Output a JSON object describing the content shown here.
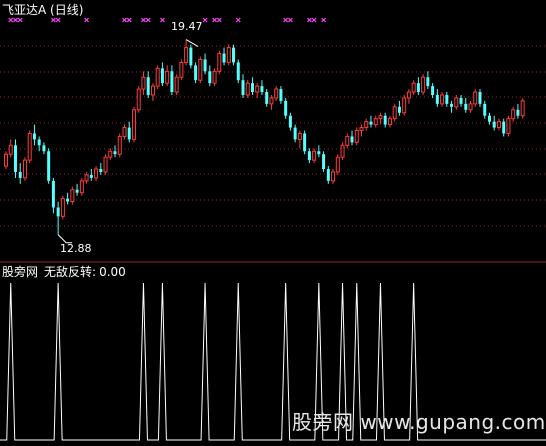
{
  "window": {
    "title": "飞亚达A (日线)"
  },
  "indicator_panel": {
    "source_label": "股旁网",
    "indicator_name": "无敌反转:",
    "indicator_value": "0.00"
  },
  "price_labels": {
    "high": "19.47",
    "low": "12.88"
  },
  "watermark": "股旁网 www.gupang.com",
  "colors": {
    "background": "#000000",
    "up_candle": "#ff3b3b",
    "down_candle": "#54ffff",
    "marker": "#ff44ff",
    "grid": "#8b2a2a",
    "indicator_line": "#ffffff"
  },
  "chart_data": {
    "type": "candlestick",
    "price_range": [
      12.5,
      20.2
    ],
    "candles": [
      [
        15.2,
        15.7,
        15.1,
        15.6
      ],
      [
        15.6,
        16.1,
        15.5,
        15.9
      ],
      [
        15.9,
        16.1,
        14.8,
        15.0
      ],
      [
        15.0,
        15.3,
        14.6,
        14.8
      ],
      [
        14.8,
        15.5,
        14.7,
        15.4
      ],
      [
        15.4,
        16.4,
        15.3,
        16.3
      ],
      [
        16.3,
        16.6,
        15.9,
        16.1
      ],
      [
        16.1,
        16.2,
        15.7,
        15.9
      ],
      [
        15.9,
        16.0,
        15.6,
        15.7
      ],
      [
        15.7,
        15.8,
        14.6,
        14.7
      ],
      [
        14.7,
        14.8,
        13.6,
        13.8
      ],
      [
        13.8,
        14.0,
        12.88,
        13.5
      ],
      [
        13.5,
        14.2,
        13.4,
        14.1
      ],
      [
        14.1,
        14.3,
        13.9,
        14.0
      ],
      [
        14.0,
        14.5,
        13.9,
        14.4
      ],
      [
        14.4,
        14.6,
        14.2,
        14.3
      ],
      [
        14.3,
        14.8,
        14.2,
        14.7
      ],
      [
        14.7,
        15.0,
        14.6,
        14.9
      ],
      [
        14.9,
        15.1,
        14.7,
        14.8
      ],
      [
        14.8,
        15.2,
        14.7,
        15.1
      ],
      [
        15.1,
        15.3,
        14.9,
        15.0
      ],
      [
        15.0,
        15.6,
        14.9,
        15.5
      ],
      [
        15.5,
        15.8,
        15.4,
        15.7
      ],
      [
        15.7,
        15.9,
        15.5,
        15.6
      ],
      [
        15.6,
        16.3,
        15.5,
        16.2
      ],
      [
        16.2,
        16.6,
        16.1,
        16.5
      ],
      [
        16.5,
        16.7,
        16.0,
        16.1
      ],
      [
        16.1,
        17.2,
        16.0,
        17.1
      ],
      [
        17.1,
        17.9,
        17.0,
        17.8
      ],
      [
        17.8,
        18.4,
        17.6,
        18.2
      ],
      [
        18.2,
        18.4,
        17.5,
        17.6
      ],
      [
        17.6,
        18.0,
        17.4,
        17.9
      ],
      [
        17.9,
        18.6,
        17.8,
        18.5
      ],
      [
        18.5,
        18.7,
        17.9,
        18.0
      ],
      [
        18.0,
        18.6,
        17.9,
        18.4
      ],
      [
        18.4,
        18.6,
        17.6,
        17.7
      ],
      [
        17.7,
        18.3,
        17.6,
        18.2
      ],
      [
        18.2,
        18.8,
        18.1,
        18.7
      ],
      [
        18.7,
        19.47,
        18.6,
        19.2
      ],
      [
        19.2,
        19.3,
        18.5,
        18.6
      ],
      [
        18.6,
        18.7,
        18.0,
        18.1
      ],
      [
        18.1,
        18.9,
        18.0,
        18.8
      ],
      [
        18.8,
        19.0,
        18.3,
        18.4
      ],
      [
        18.4,
        18.6,
        17.9,
        18.0
      ],
      [
        18.0,
        18.5,
        17.9,
        18.4
      ],
      [
        18.4,
        19.1,
        18.3,
        19.0
      ],
      [
        19.0,
        19.2,
        18.6,
        18.7
      ],
      [
        18.7,
        19.3,
        18.6,
        19.2
      ],
      [
        19.2,
        19.3,
        18.6,
        18.7
      ],
      [
        18.7,
        18.8,
        18.0,
        18.1
      ],
      [
        18.1,
        18.3,
        17.5,
        17.6
      ],
      [
        17.6,
        18.1,
        17.5,
        18.0
      ],
      [
        18.0,
        18.2,
        17.6,
        17.7
      ],
      [
        17.7,
        18.0,
        17.5,
        17.9
      ],
      [
        17.9,
        18.1,
        17.6,
        17.7
      ],
      [
        17.7,
        17.8,
        17.2,
        17.3
      ],
      [
        17.3,
        17.6,
        17.1,
        17.5
      ],
      [
        17.5,
        17.9,
        17.4,
        17.8
      ],
      [
        17.8,
        17.9,
        17.3,
        17.4
      ],
      [
        17.4,
        17.5,
        16.8,
        16.9
      ],
      [
        16.9,
        17.0,
        16.4,
        16.5
      ],
      [
        16.5,
        16.6,
        16.0,
        16.1
      ],
      [
        16.1,
        16.4,
        15.8,
        16.3
      ],
      [
        16.3,
        16.4,
        15.6,
        15.7
      ],
      [
        15.7,
        15.8,
        15.3,
        15.4
      ],
      [
        15.4,
        15.8,
        15.3,
        15.7
      ],
      [
        15.7,
        15.9,
        15.5,
        15.6
      ],
      [
        15.6,
        15.7,
        15.0,
        15.1
      ],
      [
        15.1,
        15.2,
        14.6,
        14.7
      ],
      [
        14.7,
        15.1,
        14.6,
        15.0
      ],
      [
        15.0,
        15.6,
        14.9,
        15.5
      ],
      [
        15.5,
        16.0,
        15.4,
        15.9
      ],
      [
        15.9,
        16.3,
        15.8,
        16.2
      ],
      [
        16.2,
        16.4,
        15.9,
        16.0
      ],
      [
        16.0,
        16.5,
        15.9,
        16.4
      ],
      [
        16.4,
        16.6,
        16.2,
        16.5
      ],
      [
        16.5,
        16.8,
        16.4,
        16.7
      ],
      [
        16.7,
        16.9,
        16.5,
        16.6
      ],
      [
        16.6,
        16.9,
        16.5,
        16.8
      ],
      [
        16.8,
        17.0,
        16.6,
        16.9
      ],
      [
        16.9,
        17.0,
        16.5,
        16.6
      ],
      [
        16.6,
        16.9,
        16.5,
        16.8
      ],
      [
        16.8,
        17.3,
        16.7,
        17.2
      ],
      [
        17.2,
        17.4,
        16.9,
        17.0
      ],
      [
        17.0,
        17.6,
        16.9,
        17.5
      ],
      [
        17.5,
        17.8,
        17.3,
        17.7
      ],
      [
        17.7,
        18.1,
        17.6,
        18.0
      ],
      [
        18.0,
        18.2,
        17.6,
        17.7
      ],
      [
        17.7,
        18.3,
        17.6,
        18.2
      ],
      [
        18.2,
        18.4,
        17.8,
        17.9
      ],
      [
        17.9,
        18.0,
        17.5,
        17.6
      ],
      [
        17.6,
        17.8,
        17.2,
        17.3
      ],
      [
        17.3,
        17.7,
        17.2,
        17.6
      ],
      [
        17.6,
        17.7,
        17.2,
        17.3
      ],
      [
        17.3,
        17.4,
        17.0,
        17.2
      ],
      [
        17.2,
        17.6,
        17.1,
        17.5
      ],
      [
        17.5,
        17.6,
        17.2,
        17.3
      ],
      [
        17.3,
        17.5,
        17.0,
        17.1
      ],
      [
        17.1,
        17.4,
        17.0,
        17.3
      ],
      [
        17.3,
        17.8,
        17.2,
        17.7
      ],
      [
        17.7,
        17.8,
        17.2,
        17.3
      ],
      [
        17.3,
        17.4,
        16.8,
        16.9
      ],
      [
        16.9,
        17.0,
        16.6,
        16.7
      ],
      [
        16.7,
        16.9,
        16.4,
        16.5
      ],
      [
        16.5,
        16.8,
        16.4,
        16.7
      ],
      [
        16.7,
        16.8,
        16.2,
        16.3
      ],
      [
        16.3,
        16.9,
        16.2,
        16.8
      ],
      [
        16.8,
        17.2,
        16.7,
        17.1
      ],
      [
        17.1,
        17.3,
        16.8,
        16.9
      ],
      [
        16.9,
        17.5,
        16.8,
        17.4
      ]
    ],
    "marker_bars": [
      1,
      2,
      3,
      10,
      11,
      17,
      25,
      26,
      29,
      30,
      33,
      42,
      44,
      45,
      49,
      59,
      60,
      64,
      65,
      67
    ],
    "indicator": {
      "name": "无敌反转",
      "last_value": 0.0,
      "range": [
        0,
        1
      ],
      "spike_bars": [
        1,
        11,
        29,
        33,
        42,
        49,
        59,
        66,
        71,
        74,
        79,
        86
      ]
    }
  }
}
